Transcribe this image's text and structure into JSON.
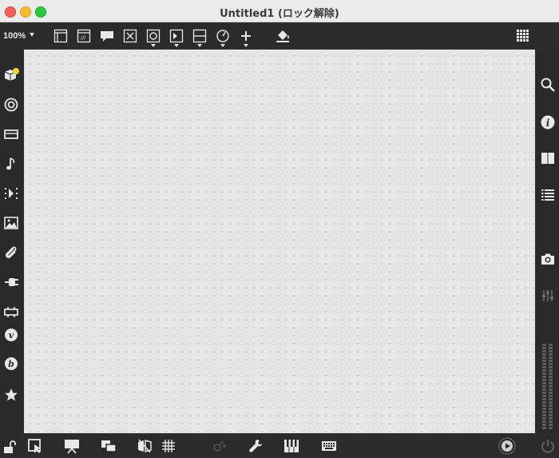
{
  "window": {
    "title": "Untitled1 (ロック解除)"
  },
  "toolbar": {
    "zoom_value": "100%",
    "icons": [
      "message-box-icon",
      "comment-box-icon",
      "speech-bubble-icon",
      "button-x-icon",
      "toggle-icon",
      "number-box-icon",
      "slider-icon",
      "dial-icon",
      "add-icon",
      "paint-bucket-icon",
      "grid-apps-icon"
    ]
  },
  "sidebar_left": [
    "objects-icon",
    "target-icon",
    "device-icon",
    "music-note-icon",
    "sequence-icon",
    "image-icon",
    "paperclip-icon",
    "plug-icon",
    "connector-icon",
    "vst-icon",
    "bpatcher-icon",
    "star-icon"
  ],
  "sidebar_right": [
    "search-icon",
    "info-icon",
    "book-icon",
    "list-icon",
    "camera-icon",
    "mixer-icon"
  ],
  "bottombar": [
    "lock-icon",
    "presentation-select-icon",
    "presentation-icon",
    "layers-icon",
    "no-flip-icon",
    "grid-icon",
    "wand-icon",
    "wrench-icon",
    "piano-icon",
    "keyboard-icon",
    "play-icon",
    "power-icon"
  ],
  "colors": {
    "chrome": "#2b2b2b",
    "canvas": "#e6e6e6",
    "icon": "#e8e8e8",
    "accent_yellow": "#f6d53a"
  }
}
